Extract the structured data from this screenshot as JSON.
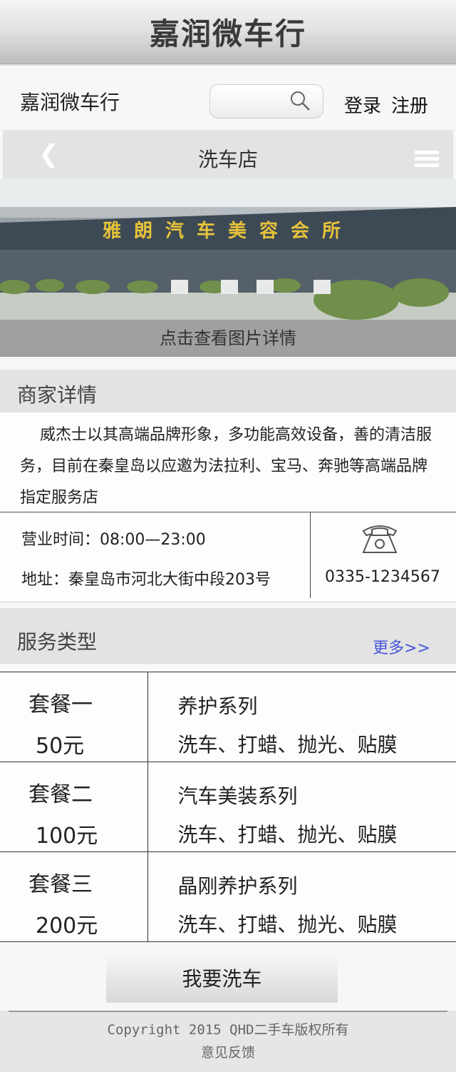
{
  "app_title": "嘉润微车行",
  "header": {
    "brand": "嘉润微车行",
    "login": "登录",
    "register": "注册"
  },
  "pagebar": {
    "back": "❮",
    "title": "洗车店"
  },
  "banner": {
    "sign_text": "雅朗汽车美容会所",
    "caption": "点击查看图片详情"
  },
  "merchant": {
    "section_title": "商家详情",
    "description": "威杰士以其高端品牌形象，多功能高效设备，善的清洁服务，目前在秦皇岛以应邀为法拉利、宝马、奔驰等高端品牌指定服务店",
    "hours": "营业时间：08:00—23:00",
    "address": "地址：秦皇岛市河北大街中段203号",
    "phone": "0335-1234567"
  },
  "services": {
    "section_title": "服务类型",
    "more": "更多>>",
    "packages": [
      {
        "name": "套餐一",
        "price": "50元",
        "series": "养护系列",
        "items": "洗车、打蜡、抛光、贴膜"
      },
      {
        "name": "套餐二",
        "price": "100元",
        "series": "汽车美装系列",
        "items": "洗车、打蜡、抛光、贴膜"
      },
      {
        "name": "套餐三",
        "price": "200元",
        "series": "晶刚养护系列",
        "items": "洗车、打蜡、抛光、贴膜"
      }
    ]
  },
  "wash_button": "我要洗车",
  "footer": {
    "copyright": "Copyright  2015 QHD二手车版权所有",
    "feedback": "意见反馈"
  },
  "colors": {
    "link_blue": "#4455dd",
    "section_bg": "#e3e3e3"
  }
}
